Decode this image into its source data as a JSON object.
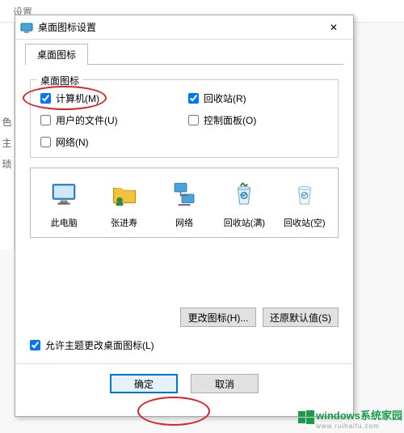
{
  "background": {
    "header": "设置",
    "sidebar": [
      "色",
      "主",
      "琐"
    ]
  },
  "dialog": {
    "title": "桌面图标设置",
    "close_label": "✕",
    "tab": "桌面图标",
    "group_label": "桌面图标",
    "checkboxes": {
      "computer": {
        "label": "计算机(M)",
        "checked": true
      },
      "recycle": {
        "label": "回收站(R)",
        "checked": true
      },
      "userfiles": {
        "label": "用户的文件(U)",
        "checked": false
      },
      "ctrlpanel": {
        "label": "控制面板(O)",
        "checked": false
      },
      "network": {
        "label": "网络(N)",
        "checked": false
      }
    },
    "icons": {
      "this_pc": "此电脑",
      "user_folder": "张进寿",
      "network": "网络",
      "recycle_full": "回收站(满)",
      "recycle_empty": "回收站(空)"
    },
    "buttons": {
      "change_icon": "更改图标(H)...",
      "restore_default": "还原默认值(S)"
    },
    "allow_themes": {
      "label": "允许主题更改桌面图标(L)",
      "checked": true
    },
    "footer": {
      "ok": "确定",
      "cancel": "取消"
    }
  },
  "watermark": {
    "brand": "windows系统家园",
    "url": "www.ruihaifu.com"
  }
}
